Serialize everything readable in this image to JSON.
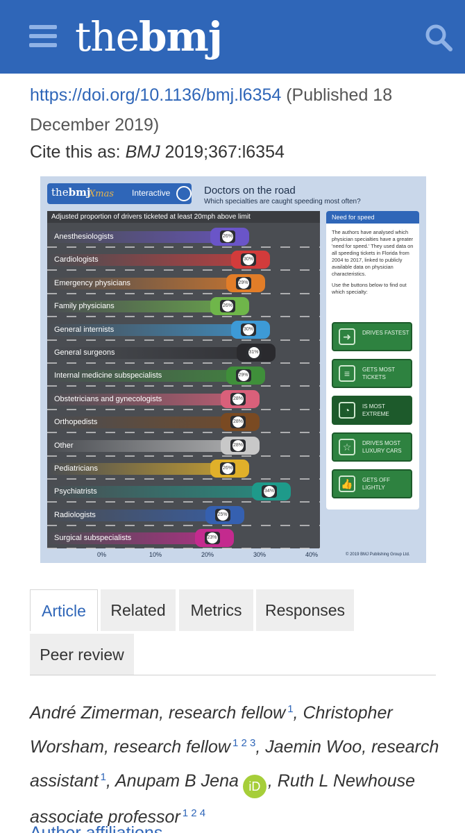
{
  "header": {
    "logo_the": "the",
    "logo_bmj": "bmj",
    "menu_icon": "hamburger-menu-icon",
    "search_icon": "search-icon",
    "bg_color": "#2f66b8"
  },
  "citation": {
    "doi_url": "https://doi.org/10.1136/bmj.l6354",
    "published_text": " (Published 18 December 2019)",
    "cite_prefix": "Cite this as: ",
    "cite_journal": "BMJ",
    "cite_ref": " 2019;367:l6354"
  },
  "infographic": {
    "badge_logo_the": "the",
    "badge_logo_bmj": "bmj",
    "badge_xmas": "Xmas",
    "badge_label": "Interactive",
    "title": "Doctors on the road",
    "subtitle": "Which specialties are caught speeding most often?",
    "road_caption": "Adjusted proportion of drivers ticketed at least 20mph above limit",
    "copyright": "© 2019 BMJ Publishing Group Ltd.",
    "side_panel": {
      "heading": "Need for speed",
      "text": "The authors have analysed which physician specialties have a greater 'need for speed.' They used data on all speeding tickets in Florida from 2004 to 2017, linked to publicly available data on physician characteristics.",
      "text2": "Use the buttons below to find out which specialty:",
      "buttons": [
        {
          "label": "DRIVES FASTEST",
          "icon": "arrow-right-icon"
        },
        {
          "label": "GETS MOST TICKETS",
          "icon": "ticket-stack-icon"
        },
        {
          "label": "IS MOST EXTREME",
          "icon": "speedometer-icon"
        },
        {
          "label": "DRIVES MOST LUXURY CARS",
          "icon": "star-icon"
        },
        {
          "label": "GETS OFF LIGHTLY",
          "icon": "thumbs-up-icon"
        }
      ]
    }
  },
  "chart_data": {
    "type": "bar",
    "ylabel": "Adjusted proportion of drivers ticketed at least 20mph above limit",
    "xlim": [
      0,
      40
    ],
    "ticks": [
      "0%",
      "10%",
      "20%",
      "30%",
      "40%"
    ],
    "categories": [
      "Anesthesiologists",
      "Cardiologists",
      "Emergency physicians",
      "Family physicians",
      "General internists",
      "General surgeons",
      "Internal medicine subspecialists",
      "Obstetricians and gynecologists",
      "Orthopedists",
      "Other",
      "Pediatricians",
      "Psychiatrists",
      "Radiologists",
      "Surgical subspecialists"
    ],
    "values": [
      26,
      30,
      29,
      26,
      30,
      31,
      29,
      28,
      28,
      28,
      26,
      34,
      25,
      23
    ],
    "value_labels": [
      "26%",
      "30%",
      "29%",
      "26%",
      "30%",
      "31%",
      "29%",
      "28%",
      "28%",
      "28%",
      "26%",
      "34%",
      "25%",
      "23%"
    ],
    "colors": [
      "#6a55c8",
      "#d23b3b",
      "#e27d28",
      "#6fb64a",
      "#3d9ad6",
      "#2a2a2e",
      "#3f8f3a",
      "#d9607a",
      "#7a4a22",
      "#c8c8c8",
      "#e0b02a",
      "#1e9a8a",
      "#3560b0",
      "#c42a8e"
    ]
  },
  "tabs": [
    {
      "label": "Article",
      "active": true
    },
    {
      "label": "Related",
      "active": false
    },
    {
      "label": "Metrics",
      "active": false
    },
    {
      "label": "Responses",
      "active": false
    },
    {
      "label": "Peer review",
      "active": false
    }
  ],
  "authors": {
    "a1": "André Zimerman, research fellow",
    "a1_sup": "1",
    "a2": "Christopher Worsham, research fellow",
    "a2_sup": "1 2 3",
    "a3": "Jaemin Woo, research assistant",
    "a3_sup": "1",
    "a4": "Anupam B Jena",
    "orcid_label": "iD",
    "a5": "Ruth L Newhouse associate professor",
    "a5_sup": "1 2 4"
  },
  "more_link": "Author affiliations"
}
